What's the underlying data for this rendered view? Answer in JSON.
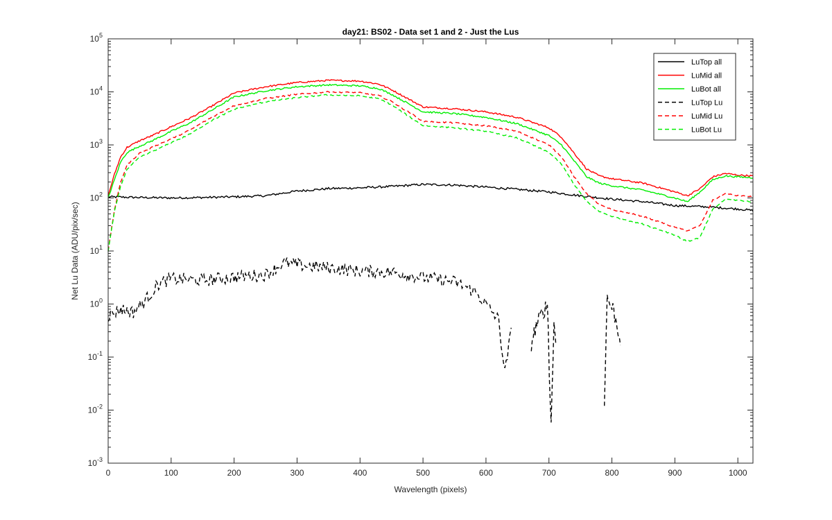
{
  "chart_data": {
    "type": "line",
    "title": "day21: BS02 - Data set 1 and 2 - Just the Lus",
    "xlabel": "Wavelength (pixels)",
    "ylabel": "Net Lu Data (ADU/pix/sec)",
    "xlim": [
      0,
      1024
    ],
    "ylim": [
      0.001,
      100000
    ],
    "yscale": "log",
    "xticks": [
      0,
      100,
      200,
      300,
      400,
      500,
      600,
      700,
      800,
      900,
      1000
    ],
    "xtick_labels": [
      "0",
      "100",
      "200",
      "300",
      "400",
      "500",
      "600",
      "700",
      "800",
      "900",
      "1000"
    ],
    "yticks": [
      0.001,
      0.01,
      0.1,
      1,
      10,
      100,
      1000,
      10000,
      100000
    ],
    "ytick_exponents": [
      "-3",
      "-2",
      "-1",
      "0",
      "1",
      "2",
      "3",
      "4",
      "5"
    ],
    "ytick_base": "10",
    "grid": false,
    "legend_position": "top-right",
    "series": [
      {
        "name": "LuTop  all",
        "color": "#000000",
        "dash": "solid",
        "x": [
          0,
          50,
          100,
          150,
          200,
          250,
          300,
          350,
          400,
          450,
          500,
          550,
          600,
          650,
          700,
          750,
          800,
          850,
          900,
          950,
          1000,
          1024
        ],
        "y": [
          105,
          102,
          100,
          102,
          105,
          110,
          135,
          150,
          155,
          165,
          180,
          175,
          160,
          145,
          130,
          110,
          95,
          85,
          72,
          68,
          62,
          58
        ]
      },
      {
        "name": "LuMid  all",
        "color": "#ff0000",
        "dash": "solid",
        "x": [
          0,
          10,
          20,
          30,
          50,
          70,
          100,
          130,
          160,
          200,
          250,
          300,
          350,
          400,
          430,
          450,
          500,
          550,
          600,
          650,
          700,
          720,
          740,
          760,
          780,
          800,
          850,
          900,
          920,
          940,
          960,
          980,
          1000,
          1024
        ],
        "y": [
          110,
          280,
          600,
          900,
          1200,
          1500,
          2200,
          3200,
          5000,
          9500,
          12500,
          15000,
          16500,
          16000,
          14000,
          11000,
          5200,
          4800,
          4200,
          3300,
          2100,
          1400,
          700,
          350,
          260,
          230,
          190,
          130,
          110,
          150,
          250,
          290,
          270,
          260
        ]
      },
      {
        "name": "LuBot  all",
        "color": "#00ee00",
        "dash": "solid",
        "x": [
          0,
          10,
          20,
          30,
          50,
          70,
          100,
          130,
          160,
          200,
          250,
          300,
          350,
          400,
          430,
          450,
          500,
          550,
          600,
          650,
          700,
          720,
          740,
          760,
          780,
          800,
          850,
          900,
          920,
          940,
          960,
          980,
          1000,
          1024
        ],
        "y": [
          100,
          220,
          480,
          720,
          950,
          1200,
          1800,
          2600,
          4200,
          8000,
          10500,
          12500,
          13500,
          13000,
          11500,
          9000,
          4200,
          3900,
          3300,
          2500,
          1500,
          1000,
          500,
          250,
          190,
          170,
          140,
          100,
          85,
          130,
          220,
          260,
          250,
          240
        ]
      },
      {
        "name": "LuTop  Lu",
        "color": "#000000",
        "dash": "dashed",
        "x": [
          0,
          20,
          40,
          60,
          80,
          100,
          150,
          200,
          250,
          280,
          300,
          350,
          400,
          450,
          500,
          550,
          580,
          600,
          620,
          630,
          640
        ],
        "y": [
          0.6,
          0.8,
          0.7,
          1.2,
          2.4,
          3.0,
          2.8,
          3.2,
          3.6,
          6.0,
          5.5,
          4.8,
          4.2,
          4.0,
          3.2,
          2.6,
          1.8,
          1.0,
          0.5,
          0.05,
          0.3
        ],
        "segments": [
          {
            "x": [
              672,
              680,
              690,
              698,
              703,
              708,
              712
            ],
            "y": [
              0.18,
              0.4,
              0.7,
              1.0,
              0.004,
              0.4,
              0.15
            ]
          },
          {
            "x": [
              788,
              792,
              797,
              802,
              808,
              814
            ],
            "y": [
              0.012,
              1.3,
              1.0,
              0.8,
              0.4,
              0.2
            ]
          }
        ]
      },
      {
        "name": "LuMid  Lu",
        "color": "#ff0000",
        "dash": "dashed",
        "x": [
          0,
          10,
          20,
          30,
          50,
          70,
          100,
          130,
          160,
          200,
          250,
          300,
          350,
          400,
          430,
          450,
          500,
          550,
          600,
          650,
          700,
          720,
          740,
          760,
          780,
          800,
          850,
          900,
          920,
          940,
          960,
          980,
          1000,
          1024
        ],
        "y": [
          10,
          60,
          200,
          420,
          700,
          900,
          1300,
          1900,
          3100,
          5500,
          7500,
          9000,
          10000,
          9600,
          8500,
          6600,
          2800,
          2600,
          2300,
          1800,
          1000,
          600,
          250,
          120,
          75,
          60,
          45,
          28,
          24,
          30,
          90,
          120,
          110,
          105
        ]
      },
      {
        "name": "LuBot  Lu",
        "color": "#00ee00",
        "dash": "dashed",
        "x": [
          0,
          10,
          20,
          30,
          50,
          70,
          100,
          130,
          160,
          200,
          250,
          300,
          350,
          400,
          430,
          450,
          500,
          550,
          600,
          650,
          700,
          720,
          740,
          760,
          780,
          800,
          850,
          900,
          920,
          940,
          960,
          980,
          1000,
          1024
        ],
        "y": [
          10,
          55,
          170,
          350,
          580,
          750,
          1100,
          1600,
          2700,
          4700,
          6500,
          7800,
          8800,
          8400,
          7400,
          5700,
          2300,
          2100,
          1800,
          1350,
          720,
          430,
          180,
          85,
          55,
          45,
          32,
          20,
          15,
          18,
          60,
          95,
          90,
          85
        ]
      }
    ]
  }
}
